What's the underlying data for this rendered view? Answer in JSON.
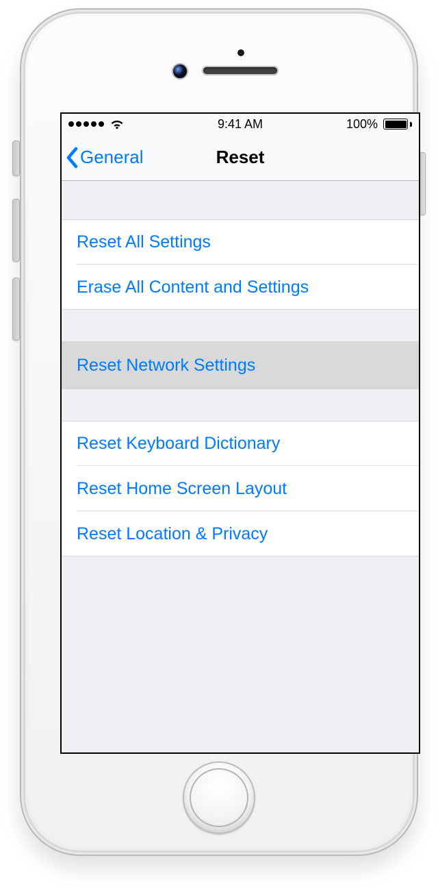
{
  "status": {
    "time": "9:41 AM",
    "battery_text": "100%"
  },
  "nav": {
    "back_label": "General",
    "title": "Reset"
  },
  "groups": {
    "first": [
      {
        "label": "Reset All Settings"
      },
      {
        "label": "Erase All Content and Settings"
      }
    ],
    "network": [
      {
        "label": "Reset Network Settings"
      }
    ],
    "third": [
      {
        "label": "Reset Keyboard Dictionary"
      },
      {
        "label": "Reset Home Screen Layout"
      },
      {
        "label": "Reset Location & Privacy"
      }
    ]
  },
  "colors": {
    "link": "#007aff"
  }
}
